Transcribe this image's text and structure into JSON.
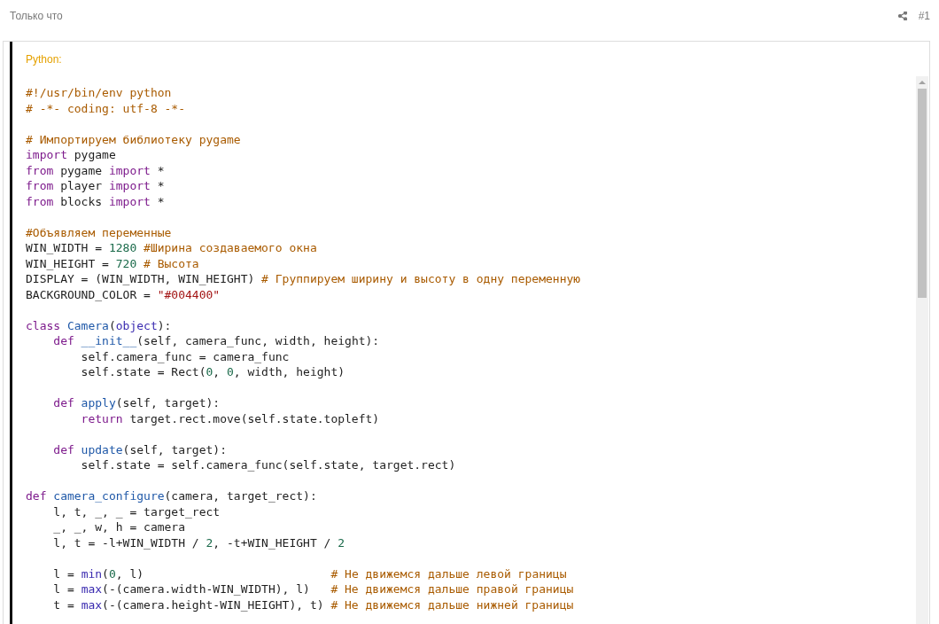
{
  "post": {
    "time": "Только что",
    "number": "#1"
  },
  "code_block": {
    "language": "Python:",
    "lines": [
      {
        "kind": "code",
        "tokens": [
          {
            "kind": "comment",
            "text": "#!/usr/bin/env python"
          }
        ]
      },
      {
        "kind": "code",
        "tokens": [
          {
            "kind": "comment",
            "text": "# -*- coding: utf-8 -*-"
          }
        ]
      },
      {
        "kind": "blank"
      },
      {
        "kind": "code",
        "tokens": [
          {
            "kind": "comment",
            "text": "# Импортируем библиотеку pygame"
          }
        ]
      },
      {
        "kind": "code",
        "tokens": [
          {
            "kind": "keyword",
            "text": "import"
          },
          {
            "kind": "plain",
            "text": " pygame"
          }
        ]
      },
      {
        "kind": "code",
        "tokens": [
          {
            "kind": "keyword",
            "text": "from"
          },
          {
            "kind": "plain",
            "text": " pygame "
          },
          {
            "kind": "keyword",
            "text": "import"
          },
          {
            "kind": "plain",
            "text": " *"
          }
        ]
      },
      {
        "kind": "code",
        "tokens": [
          {
            "kind": "keyword",
            "text": "from"
          },
          {
            "kind": "plain",
            "text": " player "
          },
          {
            "kind": "keyword",
            "text": "import"
          },
          {
            "kind": "plain",
            "text": " *"
          }
        ]
      },
      {
        "kind": "code",
        "tokens": [
          {
            "kind": "keyword",
            "text": "from"
          },
          {
            "kind": "plain",
            "text": " blocks "
          },
          {
            "kind": "keyword",
            "text": "import"
          },
          {
            "kind": "plain",
            "text": " *"
          }
        ]
      },
      {
        "kind": "blank"
      },
      {
        "kind": "code",
        "tokens": [
          {
            "kind": "comment",
            "text": "#Объявляем переменные"
          }
        ]
      },
      {
        "kind": "code",
        "tokens": [
          {
            "kind": "plain",
            "text": "WIN_WIDTH = "
          },
          {
            "kind": "number",
            "text": "1280"
          },
          {
            "kind": "comment",
            "text": " #Ширина создаваемого окна"
          }
        ]
      },
      {
        "kind": "code",
        "tokens": [
          {
            "kind": "plain",
            "text": "WIN_HEIGHT = "
          },
          {
            "kind": "number",
            "text": "720"
          },
          {
            "kind": "comment",
            "text": " # Высота"
          }
        ]
      },
      {
        "kind": "code",
        "tokens": [
          {
            "kind": "plain",
            "text": "DISPLAY = (WIN_WIDTH, WIN_HEIGHT) "
          },
          {
            "kind": "comment",
            "text": "# Группируем ширину и высоту в одну переменную"
          }
        ]
      },
      {
        "kind": "code",
        "tokens": [
          {
            "kind": "plain",
            "text": "BACKGROUND_COLOR = "
          },
          {
            "kind": "string",
            "text": "\"#004400\""
          }
        ]
      },
      {
        "kind": "blank"
      },
      {
        "kind": "code",
        "tokens": [
          {
            "kind": "keyword",
            "text": "class"
          },
          {
            "kind": "definition",
            "text": " Camera"
          },
          {
            "kind": "plain",
            "text": "("
          },
          {
            "kind": "builtin",
            "text": "object"
          },
          {
            "kind": "plain",
            "text": "):"
          }
        ]
      },
      {
        "kind": "code",
        "tokens": [
          {
            "kind": "keyword",
            "text": "    def"
          },
          {
            "kind": "definition",
            "text": " __init__"
          },
          {
            "kind": "plain",
            "text": "(self, camera_func, width, height):"
          }
        ]
      },
      {
        "kind": "code",
        "tokens": [
          {
            "kind": "plain",
            "text": "        self.camera_func = camera_func"
          }
        ]
      },
      {
        "kind": "code",
        "tokens": [
          {
            "kind": "plain",
            "text": "        self.state = Rect("
          },
          {
            "kind": "number",
            "text": "0"
          },
          {
            "kind": "plain",
            "text": ", "
          },
          {
            "kind": "number",
            "text": "0"
          },
          {
            "kind": "plain",
            "text": ", width, height)"
          }
        ]
      },
      {
        "kind": "blank"
      },
      {
        "kind": "code",
        "tokens": [
          {
            "kind": "keyword",
            "text": "    def"
          },
          {
            "kind": "definition",
            "text": " apply"
          },
          {
            "kind": "plain",
            "text": "(self, target):"
          }
        ]
      },
      {
        "kind": "code",
        "tokens": [
          {
            "kind": "keyword",
            "text": "        return"
          },
          {
            "kind": "plain",
            "text": " target.rect.move(self.state.topleft)"
          }
        ]
      },
      {
        "kind": "blank"
      },
      {
        "kind": "code",
        "tokens": [
          {
            "kind": "keyword",
            "text": "    def"
          },
          {
            "kind": "definition",
            "text": " update"
          },
          {
            "kind": "plain",
            "text": "(self, target):"
          }
        ]
      },
      {
        "kind": "code",
        "tokens": [
          {
            "kind": "plain",
            "text": "        self.state = self.camera_func(self.state, target.rect)"
          }
        ]
      },
      {
        "kind": "blank"
      },
      {
        "kind": "code",
        "tokens": [
          {
            "kind": "keyword",
            "text": "def"
          },
          {
            "kind": "definition",
            "text": " camera_configure"
          },
          {
            "kind": "plain",
            "text": "(camera, target_rect):"
          }
        ]
      },
      {
        "kind": "code",
        "tokens": [
          {
            "kind": "plain",
            "text": "    l, t, _, _ = target_rect"
          }
        ]
      },
      {
        "kind": "code",
        "tokens": [
          {
            "kind": "plain",
            "text": "    _, _, w, h = camera"
          }
        ]
      },
      {
        "kind": "code",
        "tokens": [
          {
            "kind": "plain",
            "text": "    l, t = -l+WIN_WIDTH / "
          },
          {
            "kind": "number",
            "text": "2"
          },
          {
            "kind": "plain",
            "text": ", -t+WIN_HEIGHT / "
          },
          {
            "kind": "number",
            "text": "2"
          }
        ]
      },
      {
        "kind": "blank"
      },
      {
        "kind": "code",
        "tokens": [
          {
            "kind": "plain",
            "text": "    l = "
          },
          {
            "kind": "builtin",
            "text": "min"
          },
          {
            "kind": "plain",
            "text": "("
          },
          {
            "kind": "number",
            "text": "0"
          },
          {
            "kind": "plain",
            "text": ", l)                           "
          },
          {
            "kind": "comment",
            "text": "# Не движемся дальше левой границы"
          }
        ]
      },
      {
        "kind": "code",
        "tokens": [
          {
            "kind": "plain",
            "text": "    l = "
          },
          {
            "kind": "builtin",
            "text": "max"
          },
          {
            "kind": "plain",
            "text": "(-(camera.width-WIN_WIDTH), l)   "
          },
          {
            "kind": "comment",
            "text": "# Не движемся дальше правой границы"
          }
        ]
      },
      {
        "kind": "code",
        "tokens": [
          {
            "kind": "plain",
            "text": "    t = "
          },
          {
            "kind": "builtin",
            "text": "max"
          },
          {
            "kind": "plain",
            "text": "(-(camera.height-WIN_HEIGHT), t) "
          },
          {
            "kind": "comment",
            "text": "# Не движемся дальше нижней границы"
          }
        ]
      }
    ]
  }
}
